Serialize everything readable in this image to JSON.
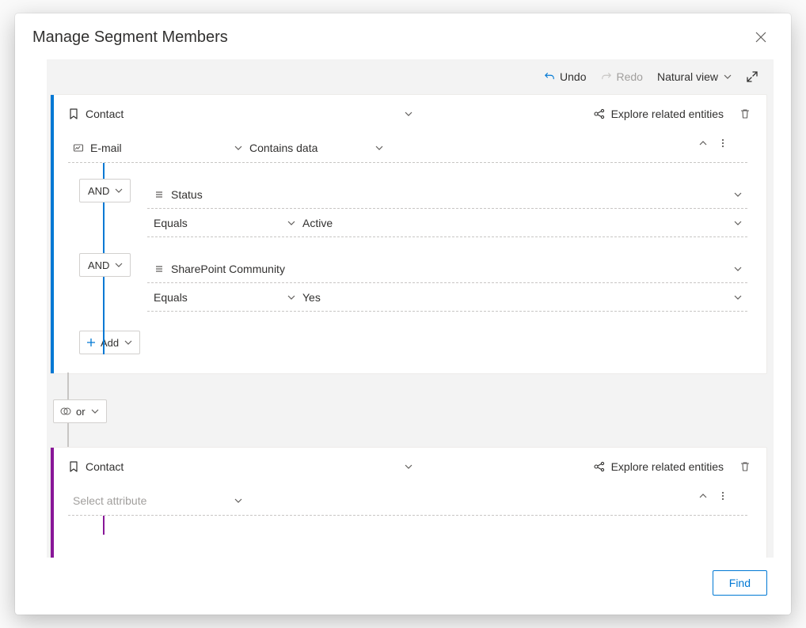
{
  "dialog": {
    "title": "Manage Segment Members"
  },
  "toolbar": {
    "undo": "Undo",
    "redo": "Redo",
    "view_label": "Natural view"
  },
  "blocks": [
    {
      "accent": "blue",
      "entity_label": "Contact",
      "explore_label": "Explore related entities",
      "primary_row": {
        "attribute": "E-mail",
        "operator": "Contains data",
        "value": ""
      },
      "conditions": [
        {
          "logic": "AND",
          "attribute": "Status",
          "operator": "Equals",
          "value": "Active"
        },
        {
          "logic": "AND",
          "attribute": "SharePoint Community",
          "operator": "Equals",
          "value": "Yes"
        }
      ],
      "add_label": "Add"
    },
    {
      "accent": "purple",
      "entity_label": "Contact",
      "explore_label": "Explore related entities",
      "primary_row": {
        "attribute_placeholder": "Select attribute"
      }
    }
  ],
  "between_logic": "or",
  "footer": {
    "find": "Find"
  }
}
